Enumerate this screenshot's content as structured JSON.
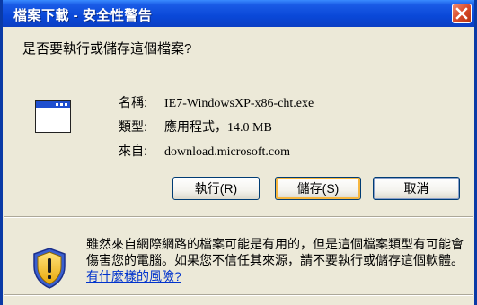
{
  "dialog": {
    "title": "檔案下載 - 安全性警告",
    "question": "是否要執行或儲存這個檔案?"
  },
  "file": {
    "name_label": "名稱:",
    "name_value": "IE7-WindowsXP-x86-cht.exe",
    "type_label": "類型:",
    "type_value": "應用程式，14.0 MB",
    "from_label": "來自:",
    "from_value": "download.microsoft.com"
  },
  "buttons": {
    "run": "執行(R)",
    "save": "儲存(S)",
    "cancel": "取消"
  },
  "warning": {
    "text": "雖然來自網際網路的檔案可能是有用的，但是這個檔案類型有可能會傷害您的電腦。如果您不信任其來源，請不要執行或儲存這個軟體。",
    "link": "有什麼樣的風險?"
  },
  "icons": {
    "close": "close-icon",
    "file": "application-window-icon",
    "shield": "security-shield-icon"
  },
  "colors": {
    "titlebar": "#0a48d8",
    "window_bg": "#ece9d8",
    "close_button": "#d94a2a",
    "link": "#0033cc",
    "default_button_highlight": "#f7b73f"
  }
}
